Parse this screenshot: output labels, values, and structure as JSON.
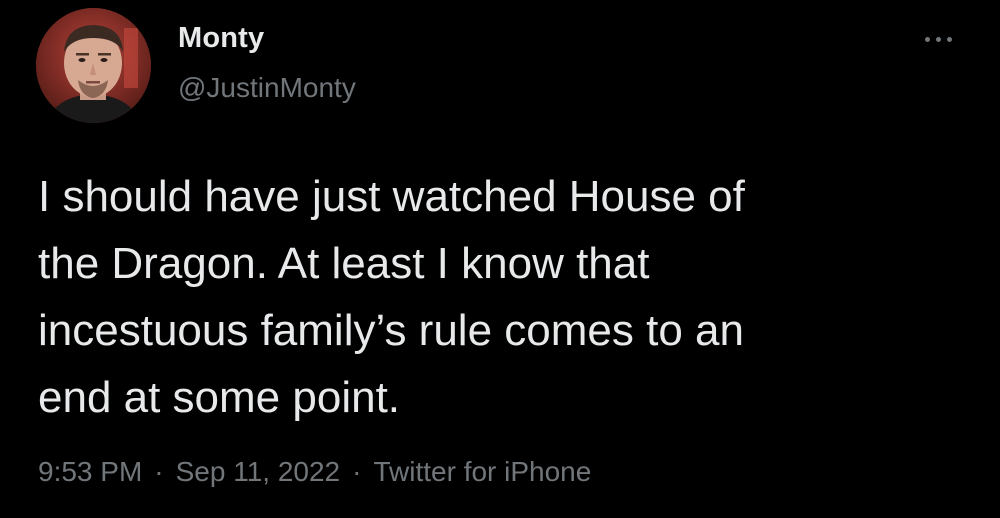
{
  "author": {
    "display_name": "Monty",
    "handle": "@JustinMonty",
    "avatar_icon": "user-avatar-photo"
  },
  "more_icon": "more-options-icon",
  "tweet": {
    "lines": [
      "I should have just watched House of",
      "the Dragon. At least I know that",
      "incestuous family’s rule comes to an",
      "end at some point."
    ]
  },
  "meta": {
    "time": "9:53 PM",
    "separator": "·",
    "date": "Sep 11, 2022",
    "source": "Twitter for iPhone"
  },
  "colors": {
    "background": "#000000",
    "primary_text": "#e7e9ea",
    "secondary_text": "#71767b"
  }
}
